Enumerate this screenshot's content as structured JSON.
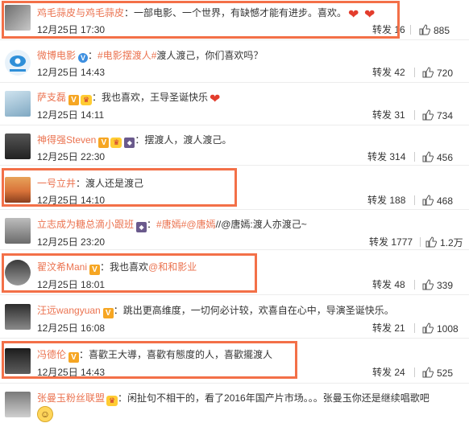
{
  "comments": [
    {
      "user": "鸡毛蒜皮与鸡毛蒜皮",
      "badges": [],
      "colon": "：",
      "text": "一部电影、一个世界，有缺憾才能有进步。喜欢。",
      "tail": "hearts2",
      "date": "12月25日 17:30",
      "repost_label": "转发",
      "repost_count": "16",
      "likes": "885"
    },
    {
      "user": "微博电影",
      "badges": [
        "v-blue"
      ],
      "colon": "：",
      "tag": "#电影摆渡人#",
      "text": "渡人渡己，你们喜欢吗？",
      "date": "12月25日 14:43",
      "repost_label": "转发",
      "repost_count": "42",
      "likes": "720"
    },
    {
      "user": "萨支磊",
      "badges": [
        "v-orange",
        "crown"
      ],
      "colon": "：",
      "text": "我也喜欢，王导圣诞快乐",
      "tail": "heart1",
      "date": "12月25日 14:11",
      "repost_label": "转发",
      "repost_count": "31",
      "likes": "734"
    },
    {
      "user": "神得强Steven",
      "badges": [
        "v-orange",
        "crown",
        "diamond"
      ],
      "colon": "：",
      "text": "摆渡人，渡人渡己。",
      "date": "12月25日 22:30",
      "repost_label": "转发",
      "repost_count": "314",
      "likes": "456"
    },
    {
      "user": "一号立井",
      "badges": [],
      "colon": "：",
      "text": "渡人还是渡己",
      "date": "12月25日 14:10",
      "repost_label": "转发",
      "repost_count": "188",
      "likes": "468"
    },
    {
      "user": "立志成为糖总滴小跟班",
      "badges": [
        "diamond"
      ],
      "colon": "：",
      "tag": "#唐嫣#@唐嫣",
      "text": "//@唐嫣:渡人亦渡己~",
      "date": "12月25日 23:20",
      "repost_label": "转发",
      "repost_count": "1777",
      "likes": "1.2万"
    },
    {
      "user": "翟汶希Mani",
      "badges": [
        "v-orange"
      ],
      "colon": "：",
      "text": "我也喜欢",
      "mention": "@和和影业",
      "date": "12月25日 18:01",
      "repost_label": "转发",
      "repost_count": "48",
      "likes": "339"
    },
    {
      "user": "汪远wangyuan",
      "badges": [
        "v-orange"
      ],
      "colon": "：",
      "text": "跳出更高维度，一切何必计较，欢喜自在心中，导演圣诞快乐。",
      "date": "12月25日 16:08",
      "repost_label": "转发",
      "repost_count": "21",
      "likes": "1008"
    },
    {
      "user": "冯德伦",
      "badges": [
        "v-orange"
      ],
      "colon": "：",
      "text": "喜歡王大導，喜歡有態度的人，喜歡擺渡人",
      "date": "12月25日 14:43",
      "repost_label": "转发",
      "repost_count": "24",
      "likes": "525"
    },
    {
      "user": "张曼玉粉丝联盟",
      "badges": [
        "crown"
      ],
      "colon": "：",
      "text": "闲扯句不相干的，看了2016年国产片市场。。。张曼玉你还是继续唱歌吧",
      "tail": "emoji",
      "date": "",
      "repost_label": "",
      "repost_count": "",
      "likes": ""
    }
  ],
  "colors": {
    "username": "#eb7350",
    "highlight": "#f37048",
    "text": "#333333"
  }
}
